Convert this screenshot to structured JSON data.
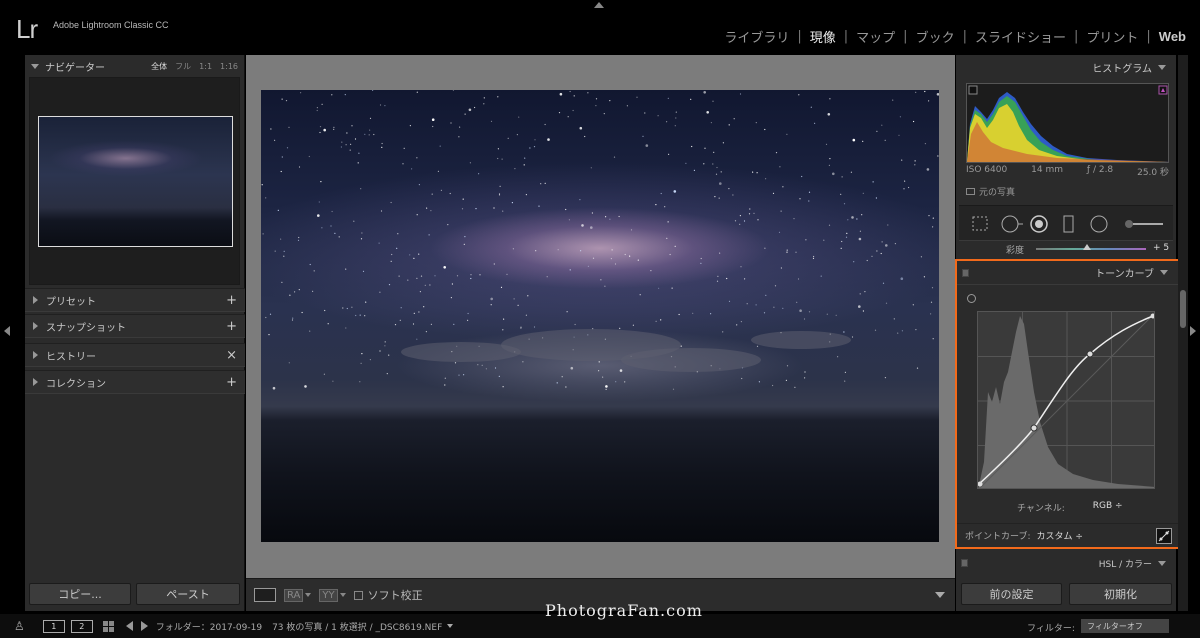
{
  "app": {
    "logo": "Lr",
    "name": "Adobe Lightroom Classic CC"
  },
  "modules": [
    {
      "label": "ライブラリ",
      "active": false
    },
    {
      "label": "現像",
      "active": true
    },
    {
      "label": "マップ",
      "active": false
    },
    {
      "label": "ブック",
      "active": false
    },
    {
      "label": "スライドショー",
      "active": false
    },
    {
      "label": "プリント",
      "active": false
    },
    {
      "label": "Web",
      "active": false
    }
  ],
  "navigator": {
    "title": "ナビゲーター",
    "zoom_options": [
      "全体",
      "フル",
      "1:1",
      "1:16"
    ],
    "active_zoom": "全体"
  },
  "left_sections": [
    {
      "label": "プリセット",
      "action": "+"
    },
    {
      "label": "スナップショット",
      "action": "+"
    },
    {
      "label": "ヒストリー",
      "action": "×"
    },
    {
      "label": "コレクション",
      "action": "+"
    }
  ],
  "left_buttons": {
    "copy": "コピー...",
    "paste": "ペースト"
  },
  "toolbar": {
    "ra": "RA",
    "yy": "YY",
    "soft_proof": "ソフト校正"
  },
  "histogram": {
    "title": "ヒストグラム",
    "iso": "ISO 6400",
    "focal": "14 mm",
    "aperture": "ƒ / 2.8",
    "shutter": "25.0 秒",
    "original_photo": "元の写真"
  },
  "saturation": {
    "label": "彩度",
    "value": "+ 5",
    "slider_fraction": 0.46
  },
  "tone_curve": {
    "title": "トーンカーブ",
    "channel_label": "チャンネル:",
    "channel_value": "RGB ÷",
    "point_curve_label": "ポイントカーブ:",
    "point_curve_value": "カスタム ÷"
  },
  "hsl": {
    "label": "HSL / カラー"
  },
  "right_buttons": {
    "previous": "前の設定",
    "reset": "初期化"
  },
  "filmstrip": {
    "view1": "1",
    "view2": "2",
    "folder": "フォルダー：2017-09-19",
    "count": "73 枚の写真 / 1 枚選択 / _DSC8619.NEF",
    "filter_label": "フィルター:",
    "filter_value": "フィルターオフ"
  },
  "watermark": "PhotograFan.com",
  "colors": {
    "highlight_border": "#f26a1b",
    "panel_bg": "#2b2b2b",
    "center_bg": "#7c7c7c"
  }
}
